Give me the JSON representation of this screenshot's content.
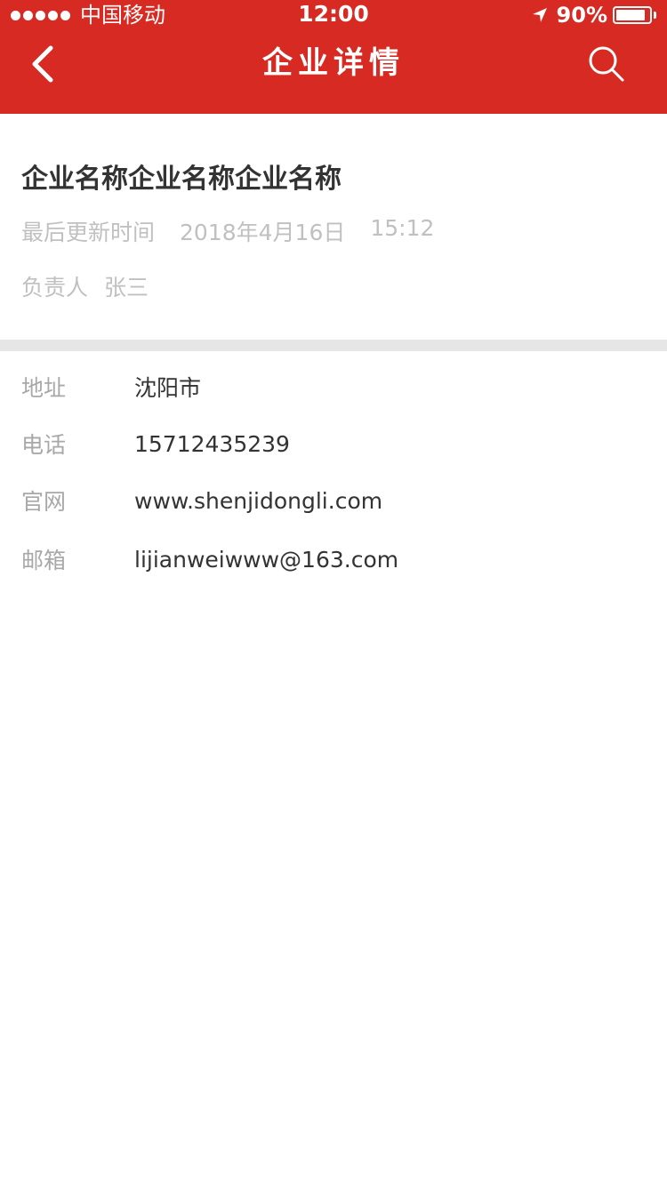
{
  "status_bar": {
    "carrier": "中国移动",
    "time": "12:00",
    "battery": "90%",
    "battery_level": 0.9,
    "signal_dots": 5
  },
  "navbar": {
    "title": "企业详情",
    "back_icon": "chevron-left-icon",
    "search_icon": "search-icon"
  },
  "company": {
    "name": "企业名称企业名称企业名称",
    "updated_label": "最后更新时间",
    "updated_date": "2018年4月16日",
    "updated_time": "15:12",
    "owner_label": "负责人",
    "owner_name": "张三"
  },
  "info": {
    "rows": [
      {
        "label": "地址",
        "value": "沈阳市"
      },
      {
        "label": "电话",
        "value": "15712435239"
      },
      {
        "label": "官网",
        "value": "www.shenjidongli.com"
      },
      {
        "label": "邮箱",
        "value": "lijianweiwww@163.com"
      }
    ]
  },
  "colors": {
    "header_bg": "#d72a22",
    "divider": "#e6e6e6",
    "label_gray": "#a8a8a8",
    "meta_gray": "#c0c0c0",
    "text_dark": "#333333"
  }
}
